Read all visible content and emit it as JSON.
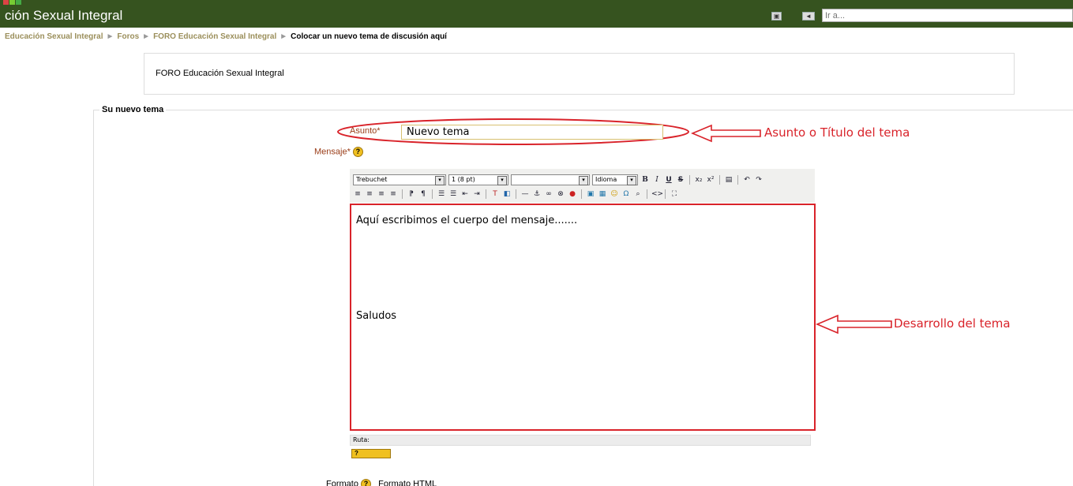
{
  "header": {
    "site_title": "ción Sexual Integral",
    "goto_placeholder": "Ir a..."
  },
  "breadcrumb": {
    "items": [
      "Educación Sexual Integral",
      "Foros",
      "FORO Educación Sexual Integral"
    ],
    "current": "Colocar un nuevo tema de discusión aquí",
    "separator": "►"
  },
  "forum": {
    "name": "FORO Educación Sexual Integral"
  },
  "form": {
    "legend": "Su nuevo tema",
    "asunto_label": "Asunto*",
    "asunto_value": "Nuevo tema",
    "mensaje_label": "Mensaje*",
    "help_glyph": "?",
    "toolbar": {
      "font_family": "Trebuchet",
      "font_size": "1 (8 pt)",
      "heading": "",
      "language": "Idioma"
    },
    "editor": {
      "line1": "Aquí escribimos el cuerpo del mensaje.......",
      "line2": "Saludos"
    },
    "path_label": "Ruta:",
    "format_label": "Formato",
    "format_value": "Formato HTML"
  },
  "annotations": {
    "subject": "Asunto o Título del tema",
    "body": "Desarrollo del tema"
  },
  "colors": {
    "header_bg": "#36531f",
    "annotation": "#d9232a",
    "required_label": "#9a3d18",
    "breadcrumb": "#9b8f5b"
  }
}
